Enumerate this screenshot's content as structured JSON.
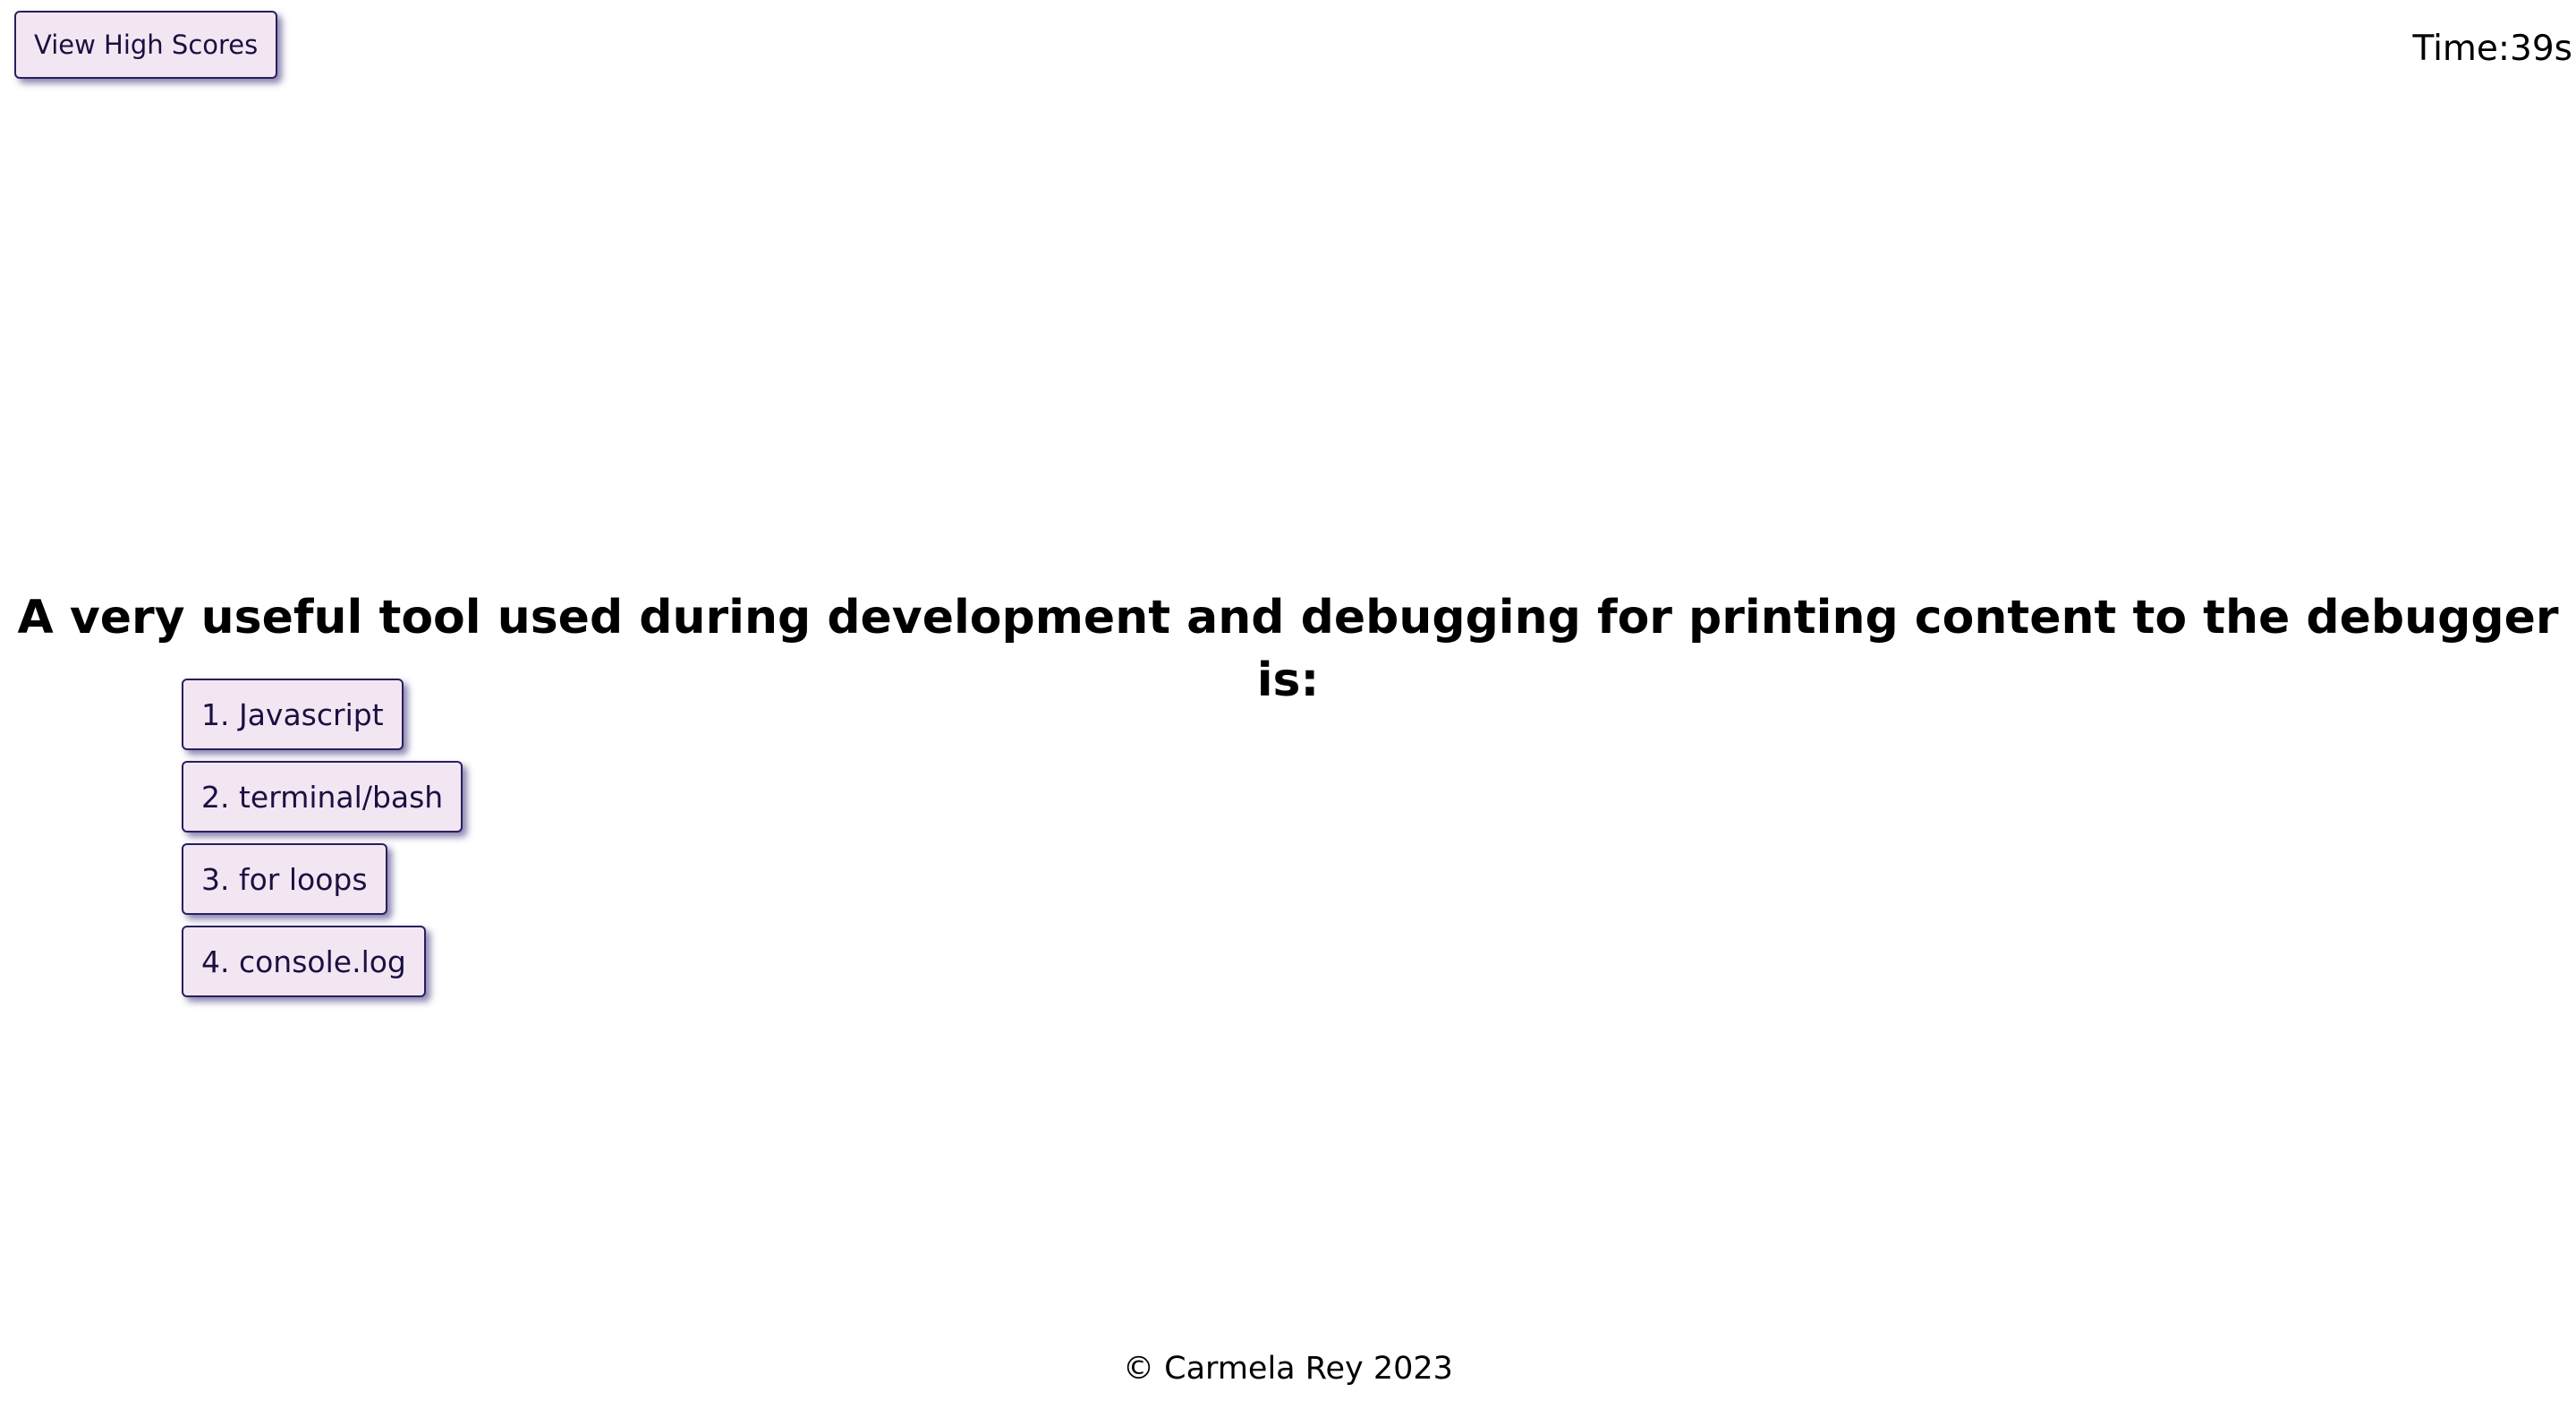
{
  "header": {
    "high_scores_label": "View High Scores",
    "timer_text": "Time:39s"
  },
  "quiz": {
    "question": "A very useful tool used during development and debugging for printing content to the debugger is:",
    "choices": [
      {
        "label": "1. Javascript"
      },
      {
        "label": "2. terminal/bash"
      },
      {
        "label": "3. for loops"
      },
      {
        "label": "4. console.log"
      }
    ]
  },
  "footer": {
    "copyright": "© Carmela Rey 2023"
  },
  "colors": {
    "button_bg": "#f3e6f3",
    "button_border": "#2a1f5c",
    "button_text": "#1a1040",
    "button_shadow": "#281e6e"
  }
}
